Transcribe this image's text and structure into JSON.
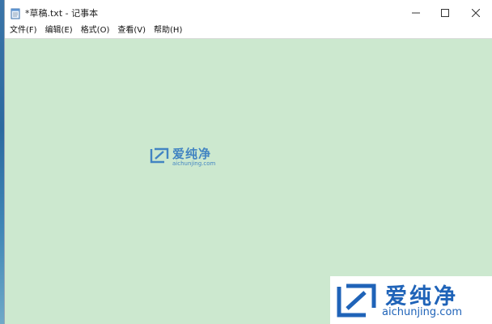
{
  "window": {
    "title": "*草稿.txt - 记事本"
  },
  "icons": {
    "app": "notepad-icon",
    "minimize": "minimize-icon",
    "maximize": "maximize-icon",
    "close": "close-icon",
    "watermark_logo": "aichunjing-logo-icon"
  },
  "menu": {
    "items": [
      {
        "label": "文件(F)"
      },
      {
        "label": "编辑(E)"
      },
      {
        "label": "格式(O)"
      },
      {
        "label": "查看(V)"
      },
      {
        "label": "帮助(H)"
      }
    ]
  },
  "editor": {
    "background": "#cce8cf"
  },
  "watermark": {
    "name": "爱纯净",
    "url": "aichunjing.com",
    "color": "#1f63b8"
  }
}
